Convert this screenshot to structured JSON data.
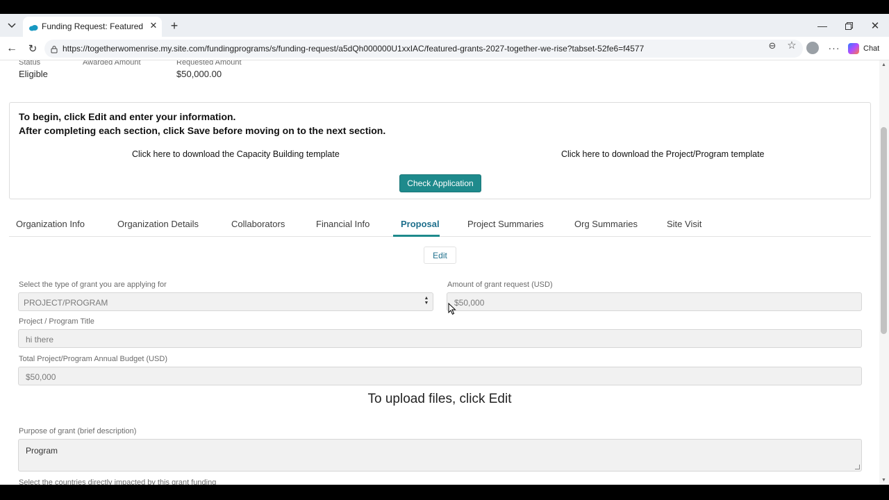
{
  "browser": {
    "tab_title": "Funding Request: Featured Grants",
    "url": "https://togetherwomenrise.my.site.com/fundingprograms/s/funding-request/a5dQh000000U1xxIAC/featured-grants-2027-together-we-rise?tabset-52fe6=f4577",
    "chat_label": "Chat",
    "icons": [
      "tab-list-icon",
      "salesforce-cloud-icon",
      "close-icon",
      "plus-icon",
      "minimize-icon",
      "restore-icon",
      "back-arrow-icon",
      "reload-icon",
      "lock-icon",
      "reader-icon",
      "star-icon",
      "avatar",
      "more-icon",
      "copilot-icon"
    ]
  },
  "summary": {
    "status_label": "Status",
    "status_value": "Eligible",
    "awarded_label": "Awarded Amount",
    "requested_label": "Requested Amount",
    "requested_value": "$50,000.00"
  },
  "instructions": {
    "line1": "To begin, click Edit and enter your information.",
    "line2": "After completing each section, click Save before moving on to the next section.",
    "capacity_link": "Click here to download the Capacity Building template",
    "project_link": "Click here to download the Project/Program template",
    "check_button": "Check Application"
  },
  "tabs": [
    "Organization Info",
    "Organization Details",
    "Collaborators",
    "Financial Info",
    "Proposal",
    "Project Summaries",
    "Org Summaries",
    "Site Visit"
  ],
  "active_tab": "Proposal",
  "accent_color": "#1e8a8c",
  "form": {
    "edit_label": "Edit",
    "grant_type_label": "Select the type of grant you are applying for",
    "grant_type_value": "PROJECT/PROGRAM",
    "amount_label": "Amount of grant request (USD)",
    "amount_value": "$50,000",
    "title_label": "Project / Program Title",
    "title_value": "hi there",
    "budget_label": "Total Project/Program Annual Budget (USD)",
    "budget_value": "$50,000",
    "upload_message": "To upload files, click Edit",
    "purpose_label": "Purpose of grant (brief description)",
    "purpose_value": "Program",
    "countries_label": "Select the countries directly impacted by this grant funding"
  }
}
